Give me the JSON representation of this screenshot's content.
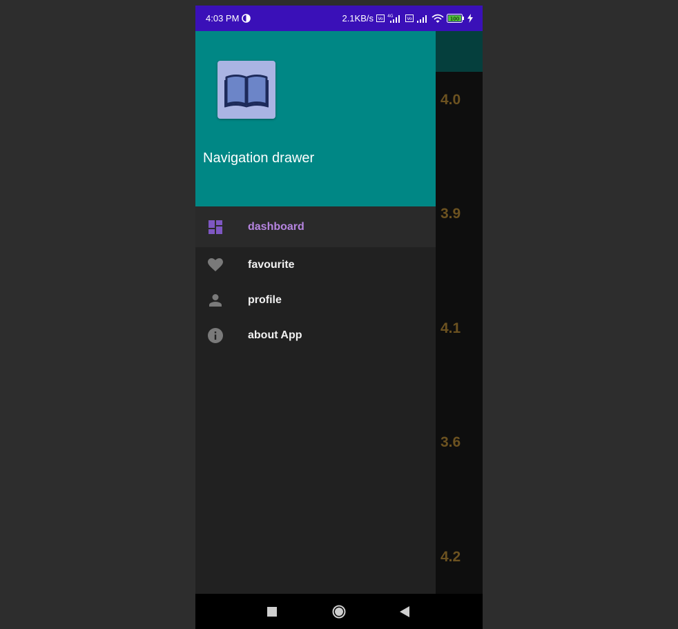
{
  "status_bar": {
    "time": "4:03 PM",
    "network_speed": "2.1KB/s",
    "network_type": "4G",
    "battery": "100",
    "icons": [
      "data-saver-icon",
      "volte-icon",
      "signal-icon",
      "volte-icon",
      "signal-icon",
      "wifi-icon",
      "battery-icon",
      "charging-icon"
    ]
  },
  "drawer": {
    "title": "Navigation drawer",
    "logo_icon": "open-book-icon",
    "items": [
      {
        "label": "dashboard",
        "icon": "dashboard-icon",
        "active": true
      },
      {
        "label": "favourite",
        "icon": "heart-icon",
        "active": false
      },
      {
        "label": "profile",
        "icon": "person-icon",
        "active": false
      },
      {
        "label": "about App",
        "icon": "info-icon",
        "active": false
      }
    ]
  },
  "background_list": {
    "ratings": [
      "4.0",
      "3.9",
      "4.1",
      "3.6",
      "4.2"
    ]
  },
  "nav_bar": {
    "buttons": [
      "recents-button",
      "home-button",
      "back-button"
    ]
  },
  "colors": {
    "status_bar": "#3a10b8",
    "drawer_header": "#008785",
    "active_accent": "#b685e0",
    "rating_text": "#6c5220"
  }
}
